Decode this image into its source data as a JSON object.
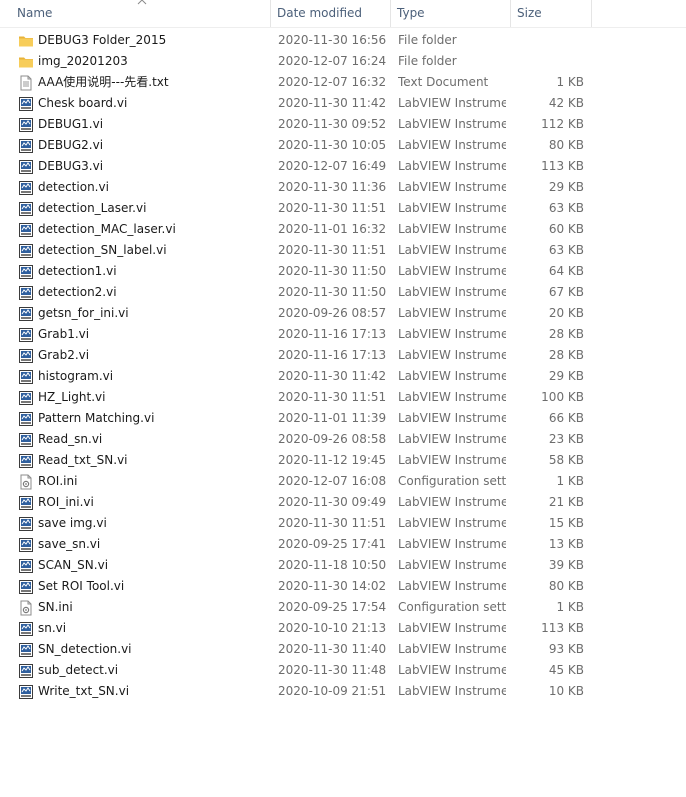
{
  "columns": {
    "name": "Name",
    "date": "Date modified",
    "type": "Type",
    "size": "Size"
  },
  "sort": {
    "column": "name",
    "direction": "ascending"
  },
  "colors": {
    "header_text": "#4c607a",
    "secondary_text": "#6d6d6d",
    "folder": "#f5c64a"
  },
  "files": [
    {
      "name": "DEBUG3 Folder_2015",
      "date": "2020-11-30 16:56",
      "type": "File folder",
      "size": "",
      "icon": "folder"
    },
    {
      "name": "img_20201203",
      "date": "2020-12-07 16:24",
      "type": "File folder",
      "size": "",
      "icon": "folder"
    },
    {
      "name": "AAA使用说明---先看.txt",
      "date": "2020-12-07 16:32",
      "type": "Text Document",
      "size": "1 KB",
      "icon": "text"
    },
    {
      "name": "Chesk board.vi",
      "date": "2020-11-30 11:42",
      "type": "LabVIEW Instrume...",
      "size": "42 KB",
      "icon": "vi"
    },
    {
      "name": "DEBUG1.vi",
      "date": "2020-11-30 09:52",
      "type": "LabVIEW Instrume...",
      "size": "112 KB",
      "icon": "vi"
    },
    {
      "name": "DEBUG2.vi",
      "date": "2020-11-30 10:05",
      "type": "LabVIEW Instrume...",
      "size": "80 KB",
      "icon": "vi"
    },
    {
      "name": "DEBUG3.vi",
      "date": "2020-12-07 16:49",
      "type": "LabVIEW Instrume...",
      "size": "113 KB",
      "icon": "vi"
    },
    {
      "name": "detection.vi",
      "date": "2020-11-30 11:36",
      "type": "LabVIEW Instrume...",
      "size": "29 KB",
      "icon": "vi"
    },
    {
      "name": "detection_Laser.vi",
      "date": "2020-11-30 11:51",
      "type": "LabVIEW Instrume...",
      "size": "63 KB",
      "icon": "vi"
    },
    {
      "name": "detection_MAC_laser.vi",
      "date": "2020-11-01 16:32",
      "type": "LabVIEW Instrume...",
      "size": "60 KB",
      "icon": "vi"
    },
    {
      "name": "detection_SN_label.vi",
      "date": "2020-11-30 11:51",
      "type": "LabVIEW Instrume...",
      "size": "63 KB",
      "icon": "vi"
    },
    {
      "name": "detection1.vi",
      "date": "2020-11-30 11:50",
      "type": "LabVIEW Instrume...",
      "size": "64 KB",
      "icon": "vi"
    },
    {
      "name": "detection2.vi",
      "date": "2020-11-30 11:50",
      "type": "LabVIEW Instrume...",
      "size": "67 KB",
      "icon": "vi"
    },
    {
      "name": "getsn_for_ini.vi",
      "date": "2020-09-26 08:57",
      "type": "LabVIEW Instrume...",
      "size": "20 KB",
      "icon": "vi"
    },
    {
      "name": "Grab1.vi",
      "date": "2020-11-16 17:13",
      "type": "LabVIEW Instrume...",
      "size": "28 KB",
      "icon": "vi"
    },
    {
      "name": "Grab2.vi",
      "date": "2020-11-16 17:13",
      "type": "LabVIEW Instrume...",
      "size": "28 KB",
      "icon": "vi"
    },
    {
      "name": "histogram.vi",
      "date": "2020-11-30 11:42",
      "type": "LabVIEW Instrume...",
      "size": "29 KB",
      "icon": "vi"
    },
    {
      "name": "HZ_Light.vi",
      "date": "2020-11-30 11:51",
      "type": "LabVIEW Instrume...",
      "size": "100 KB",
      "icon": "vi"
    },
    {
      "name": "Pattern Matching.vi",
      "date": "2020-11-01 11:39",
      "type": "LabVIEW Instrume...",
      "size": "66 KB",
      "icon": "vi"
    },
    {
      "name": "Read_sn.vi",
      "date": "2020-09-26 08:58",
      "type": "LabVIEW Instrume...",
      "size": "23 KB",
      "icon": "vi"
    },
    {
      "name": "Read_txt_SN.vi",
      "date": "2020-11-12 19:45",
      "type": "LabVIEW Instrume...",
      "size": "58 KB",
      "icon": "vi"
    },
    {
      "name": "ROI.ini",
      "date": "2020-12-07 16:08",
      "type": "Configuration sett...",
      "size": "1 KB",
      "icon": "ini"
    },
    {
      "name": "ROI_ini.vi",
      "date": "2020-11-30 09:49",
      "type": "LabVIEW Instrume...",
      "size": "21 KB",
      "icon": "vi"
    },
    {
      "name": "save img.vi",
      "date": "2020-11-30 11:51",
      "type": "LabVIEW Instrume...",
      "size": "15 KB",
      "icon": "vi"
    },
    {
      "name": "save_sn.vi",
      "date": "2020-09-25 17:41",
      "type": "LabVIEW Instrume...",
      "size": "13 KB",
      "icon": "vi"
    },
    {
      "name": "SCAN_SN.vi",
      "date": "2020-11-18 10:50",
      "type": "LabVIEW Instrume...",
      "size": "39 KB",
      "icon": "vi"
    },
    {
      "name": "Set ROI Tool.vi",
      "date": "2020-11-30 14:02",
      "type": "LabVIEW Instrume...",
      "size": "80 KB",
      "icon": "vi"
    },
    {
      "name": "SN.ini",
      "date": "2020-09-25 17:54",
      "type": "Configuration sett...",
      "size": "1 KB",
      "icon": "ini"
    },
    {
      "name": "sn.vi",
      "date": "2020-10-10 21:13",
      "type": "LabVIEW Instrume...",
      "size": "113 KB",
      "icon": "vi"
    },
    {
      "name": "SN_detection.vi",
      "date": "2020-11-30 11:40",
      "type": "LabVIEW Instrume...",
      "size": "93 KB",
      "icon": "vi"
    },
    {
      "name": "sub_detect.vi",
      "date": "2020-11-30 11:48",
      "type": "LabVIEW Instrume...",
      "size": "45 KB",
      "icon": "vi"
    },
    {
      "name": "Write_txt_SN.vi",
      "date": "2020-10-09 21:51",
      "type": "LabVIEW Instrume...",
      "size": "10 KB",
      "icon": "vi"
    }
  ]
}
